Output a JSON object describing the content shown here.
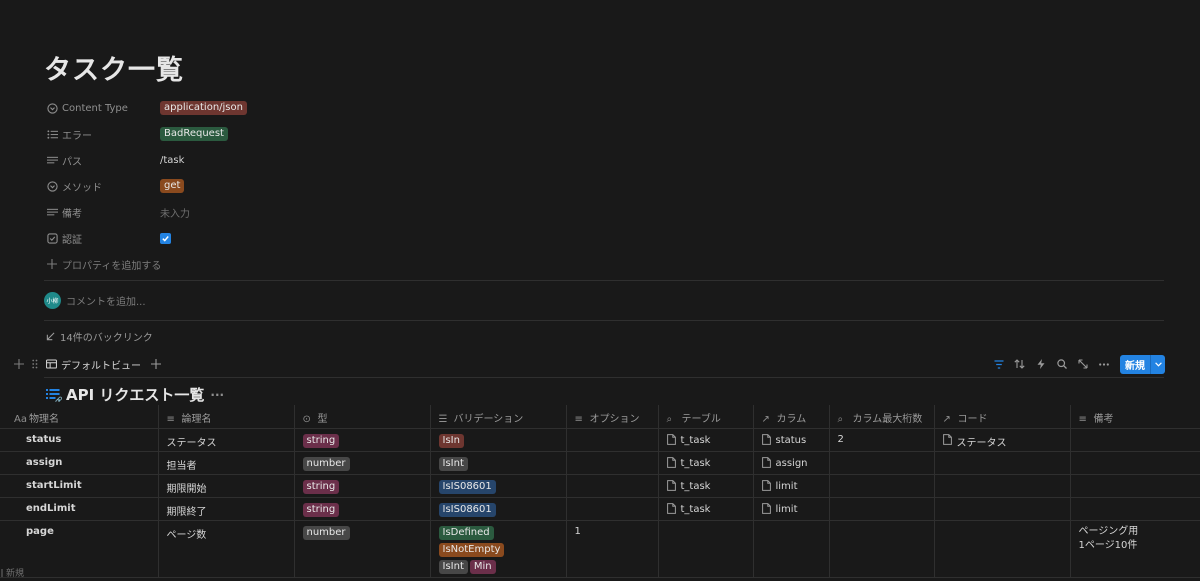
{
  "page": {
    "title": "タスク一覧"
  },
  "properties": [
    {
      "key": "content-type",
      "name": "Content Type",
      "icon": "select-icon",
      "value": "application/json",
      "kind": "tag",
      "color": "#6e3630"
    },
    {
      "key": "error",
      "name": "エラー",
      "icon": "list-icon",
      "value": "BadRequest",
      "kind": "tag",
      "color": "#2b5a3f"
    },
    {
      "key": "path",
      "name": "パス",
      "icon": "text-icon",
      "value": "/task",
      "kind": "text"
    },
    {
      "key": "method",
      "name": "メソッド",
      "icon": "select-icon",
      "value": "get",
      "kind": "tag",
      "color": "#8a4a1e"
    },
    {
      "key": "note",
      "name": "備考",
      "icon": "text-icon",
      "value": "未入力",
      "kind": "empty"
    },
    {
      "key": "auth",
      "name": "認証",
      "icon": "checkbox-icon",
      "value": true,
      "kind": "checkbox"
    }
  ],
  "add_property_label": "プロパティを追加する",
  "comment": {
    "avatar_text": "小柳",
    "placeholder": "コメントを追加..."
  },
  "backlinks_label": "14件のバックリンク",
  "view": {
    "tab_label": "デフォルトビュー",
    "new_button_label": "新規"
  },
  "database": {
    "title": "API リクエスト一覧",
    "columns": [
      {
        "label": "物理名",
        "icon": "Aa"
      },
      {
        "label": "論理名",
        "icon": "text"
      },
      {
        "label": "型",
        "icon": "select"
      },
      {
        "label": "バリデーション",
        "icon": "list"
      },
      {
        "label": "オプション",
        "icon": "text"
      },
      {
        "label": "テーブル",
        "icon": "search"
      },
      {
        "label": "カラム",
        "icon": "arrow"
      },
      {
        "label": "カラム最大桁数",
        "icon": "search"
      },
      {
        "label": "コード",
        "icon": "arrow"
      },
      {
        "label": "備考",
        "icon": "text"
      }
    ],
    "rows": [
      {
        "physical": "status",
        "logical": "ステータス",
        "type": "string",
        "validations": [
          "IsIn"
        ],
        "option": "",
        "table": "t_task",
        "column": "status",
        "max_digits": "2",
        "code": "ステータス",
        "note": []
      },
      {
        "physical": "assign",
        "logical": "担当者",
        "type": "number",
        "validations": [
          "IsInt"
        ],
        "option": "",
        "table": "t_task",
        "column": "assign",
        "max_digits": "",
        "code": "",
        "note": []
      },
      {
        "physical": "startLimit",
        "logical": "期限開始",
        "type": "string",
        "validations": [
          "IsIS08601"
        ],
        "option": "",
        "table": "t_task",
        "column": "limit",
        "max_digits": "",
        "code": "",
        "note": []
      },
      {
        "physical": "endLimit",
        "logical": "期限終了",
        "type": "string",
        "validations": [
          "IsIS08601"
        ],
        "option": "",
        "table": "t_task",
        "column": "limit",
        "max_digits": "",
        "code": "",
        "note": []
      },
      {
        "physical": "page",
        "logical": "ページ数",
        "type": "number",
        "validations": [
          "IsDefined",
          "IsNotEmpty",
          "IsInt",
          "Min"
        ],
        "option": "1",
        "table": "",
        "column": "",
        "max_digits": "",
        "code": "",
        "note": [
          "ページング用",
          "1ページ10件"
        ]
      }
    ],
    "type_colors": {
      "string": "#6b2f4a",
      "number": "#474747"
    },
    "validation_colors": {
      "IsIn": "#6e3630",
      "IsInt": "#474747",
      "IsIS08601": "#26456b",
      "IsDefined": "#2b5a3f",
      "IsNotEmpty": "#8a4a1e",
      "Min": "#6b2f4a"
    },
    "footer_new_label": "新規"
  }
}
